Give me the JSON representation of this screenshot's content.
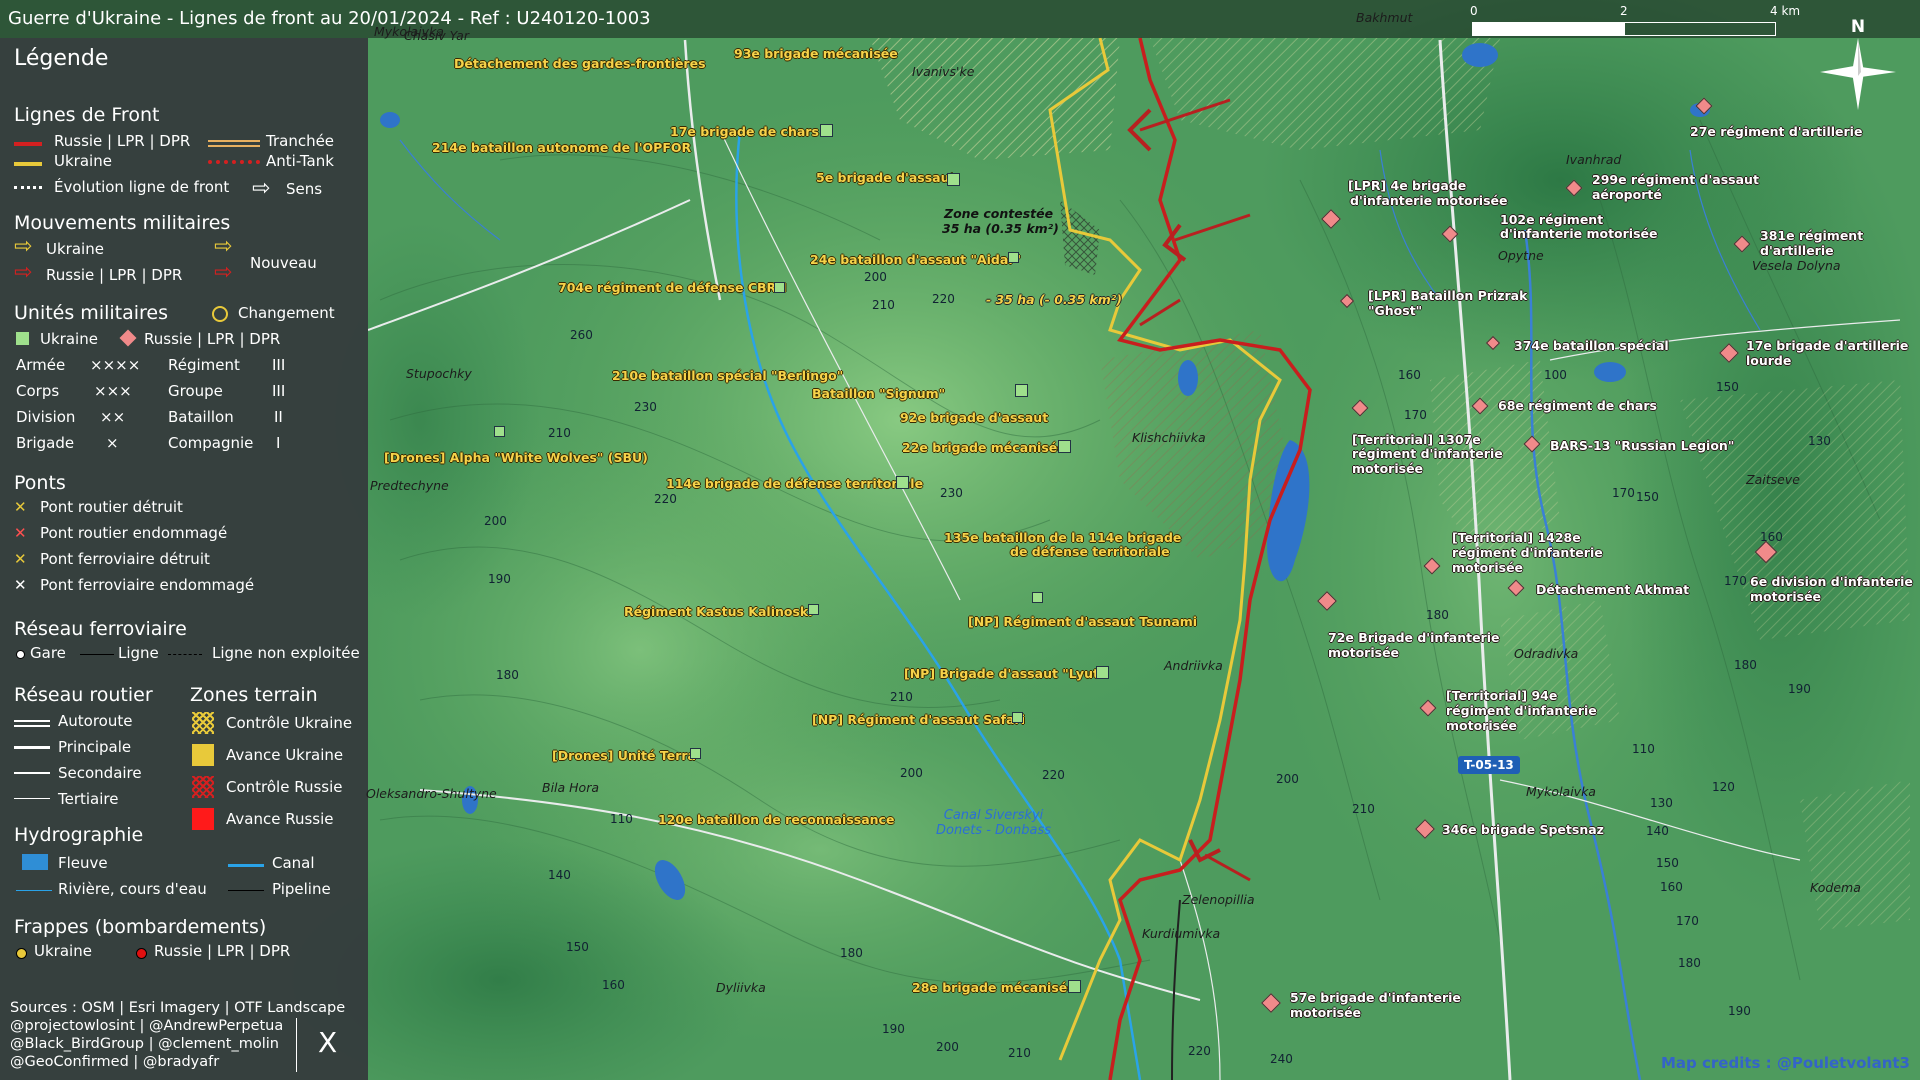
{
  "title": "Guerre d'Ukraine - Lignes de front au 20/01/2024 - Ref : U240120-1003",
  "north": "N",
  "scale": {
    "t0": "0",
    "t1": "2",
    "t2": "4 km"
  },
  "legend": {
    "title": "Légende",
    "front": {
      "title": "Lignes de Front",
      "russia": "Russie | LPR | DPR",
      "ukraine": "Ukraine",
      "evolution": "Évolution ligne de front",
      "trench": "Tranchée",
      "antitank": "Anti-Tank",
      "direction": "Sens"
    },
    "moves": {
      "title": "Mouvements militaires",
      "ukraine": "Ukraine",
      "russia": "Russie | LPR | DPR",
      "new": "Nouveau"
    },
    "units": {
      "title": "Unités militaires",
      "change": "Changement",
      "ukraine": "Ukraine",
      "russia": "Russie | LPR | DPR",
      "rows": [
        {
          "a": "Armée",
          "as": "××××",
          "b": "Régiment",
          "bs": "III"
        },
        {
          "a": "Corps",
          "as": "×××",
          "b": "Groupe",
          "bs": "III"
        },
        {
          "a": "Division",
          "as": "××",
          "b": "Bataillon",
          "bs": "II"
        },
        {
          "a": "Brigade",
          "as": "×",
          "b": "Compagnie",
          "bs": "I"
        }
      ]
    },
    "bridges": {
      "title": "Ponts",
      "items": [
        "Pont routier détruit",
        "Pont routier endommagé",
        "Pont ferroviaire détruit",
        "Pont ferroviaire endommagé"
      ]
    },
    "rail": {
      "title": "Réseau ferroviaire",
      "station": "Gare",
      "line": "Ligne",
      "unused": "Ligne non exploitée"
    },
    "roads": {
      "title": "Réseau routier",
      "items": [
        "Autoroute",
        "Principale",
        "Secondaire",
        "Tertiaire"
      ]
    },
    "zones": {
      "title": "Zones terrain",
      "items": [
        "Contrôle Ukraine",
        "Avance Ukraine",
        "Contrôle Russie",
        "Avance Russie"
      ]
    },
    "hydro": {
      "title": "Hydrographie",
      "river_big": "Fleuve",
      "canal": "Canal",
      "river": "Rivière, cours d'eau",
      "pipeline": "Pipeline"
    },
    "strikes": {
      "title": "Frappes (bombardements)",
      "ukraine": "Ukraine",
      "russia": "Russie | LPR | DPR"
    },
    "sources": [
      "Sources : OSM | Esri Imagery | OTF Landscape",
      "@projectowlosint | @AndrewPerpetua",
      "@Black_BirdGroup | @clement_molin",
      "@GeoConfirmed | @bradyafr"
    ],
    "x_logo": "X"
  },
  "units_ua": [
    "Détachement des gardes-frontières",
    "93e brigade mécanisée",
    "17e brigade de chars",
    "214e bataillon autonome de l'OPFOR",
    "5e brigade d'assaut",
    "24e bataillon d'assaut \"Aidar\"",
    "704e régiment de défense CBRN",
    "210e bataillon spécial \"Berlingo\"",
    "Bataillon \"Signum\"",
    "92e brigade d'assaut",
    "22e brigade mécanisée",
    "[Drones] Alpha \"White Wolves\" (SBU)",
    "114e brigade de défense territoriale",
    "135e bataillon de la 114e brigade",
    "de défense territoriale",
    "Régiment Kastus Kalinoski",
    "[NP] Régiment d'assaut Tsunami",
    "[NP] Brigade d'assaut \"Lyut\"",
    "[NP] Régiment d'assaut Safari",
    "[Drones] Unité Terra",
    "120e bataillon de reconnaissance",
    "28e brigade mécanisée"
  ],
  "units_ru": [
    "27e régiment d'artillerie",
    "[LPR] 4e brigade",
    "d'infanterie motorisée",
    "299e régiment d'assaut",
    "aéroporté",
    "102e régiment",
    "d'infanterie motorisée",
    "381e régiment",
    "d'artillerie",
    "[LPR] Bataillon Prizrak",
    "\"Ghost\"",
    "374e bataillon spécial",
    "17e brigade d'artillerie",
    "lourde",
    "68e régiment de chars",
    "[Territorial] 1307e",
    "régiment d'infanterie",
    "motorisée",
    "BARS-13 \"Russian Legion\"",
    "[Territorial] 1428e",
    "régiment d'infanterie",
    "motorisée",
    "Détachement Akhmat",
    "6e division d'infanterie",
    "motorisée",
    "72e Brigade d'infanterie",
    "motorisée",
    "[Territorial] 94e",
    "régiment d'infanterie",
    "motorisée",
    "346e brigade Spetsnaz",
    "57e brigade d'infanterie",
    "motorisée"
  ],
  "places": [
    "Bakhmut",
    "Mykolaivka",
    "Chasiv Yar",
    "Ivanivs'ke",
    "Ivanhrad",
    "Opytne",
    "Vesela Dolyna",
    "Stupochky",
    "Klishchiivka",
    "Predtechyne",
    "Zaitseve",
    "Odradivka",
    "Andriivka",
    "Oleksandro-Shultyne",
    "Bila Hora",
    "Mykolaivka",
    "Kodema",
    "Zelenopillia",
    "Kurdiumivka",
    "Dyliivka"
  ],
  "zone_contested": [
    "Zone contestée",
    "35 ha (0.35 km²)"
  ],
  "zone_loss": "- 35 ha (- 0.35 km²)",
  "canal": [
    "Canal Siverskyi",
    "Donets - Donbass"
  ],
  "road_badge": "T-05-13",
  "contours": [
    "200",
    "220",
    "210",
    "260",
    "230",
    "210",
    "220",
    "200",
    "190",
    "180",
    "230",
    "210",
    "200",
    "220",
    "210",
    "110",
    "140",
    "150",
    "160",
    "180",
    "190",
    "200",
    "210",
    "220",
    "240",
    "160",
    "170",
    "100",
    "150",
    "170",
    "180",
    "130",
    "150",
    "160",
    "170",
    "190",
    "180",
    "110",
    "120",
    "130",
    "140",
    "150",
    "160",
    "170",
    "180",
    "190",
    "200"
  ],
  "credit": "Map credits : @Pouletvolant3",
  "colors": {
    "russia": "#d42020",
    "ukraine": "#e8c93a",
    "legend_bg": "#34383c"
  }
}
